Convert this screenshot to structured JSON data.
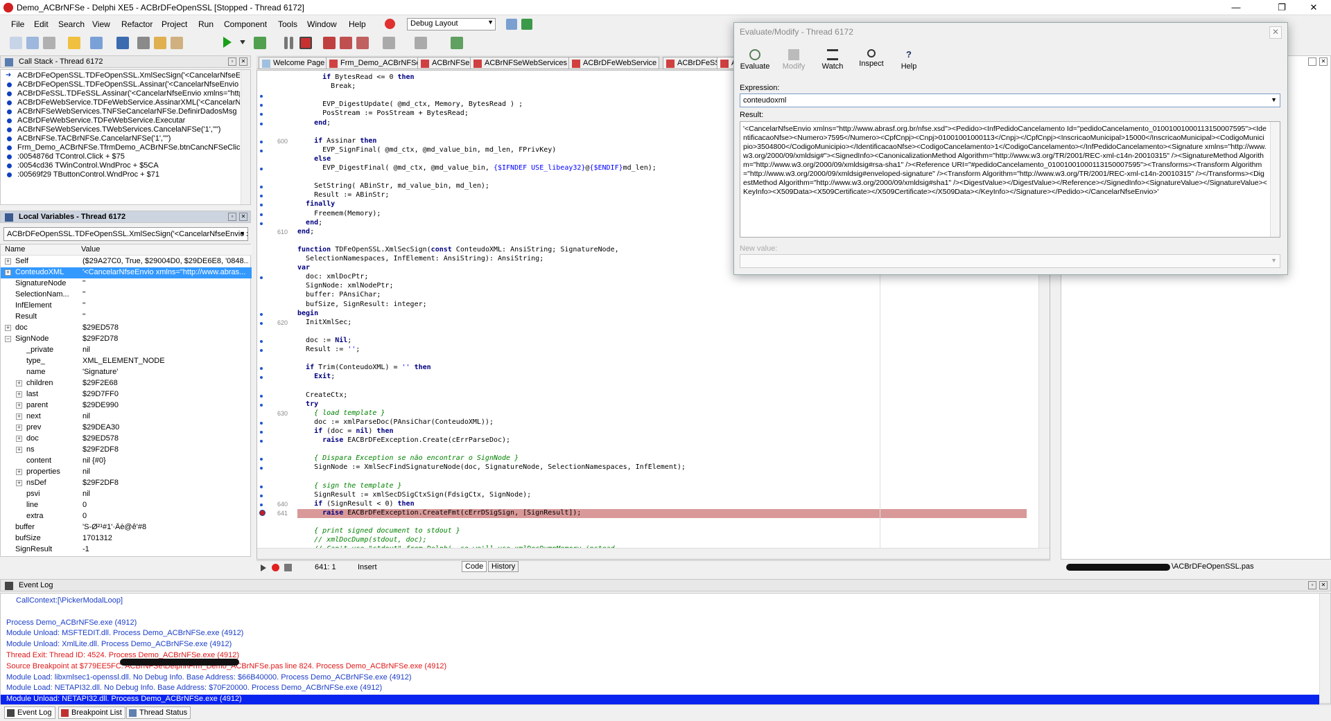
{
  "window": {
    "title": "Demo_ACBrNFSe - Delphi XE5 - ACBrDFeOpenSSL [Stopped - Thread 6172]",
    "minimize": "—",
    "restore": "❐",
    "close": "✕"
  },
  "menu": {
    "items": [
      "File",
      "Edit",
      "Search",
      "View",
      "Refactor",
      "Project",
      "Run",
      "Component",
      "Tools",
      "Window",
      "Help"
    ],
    "layout_combo": "Debug Layout"
  },
  "callstack": {
    "title": "Call Stack - Thread 6172",
    "rows": [
      "ACBrDFeOpenSSL.TDFeOpenSSL.XmlSecSign('<CancelarNfseEnvio",
      "ACBrDFeOpenSSL.TDFeOpenSSL.Assinar('<CancelarNfseEnvio xm",
      "ACBrDFeSSL.TDFeSSL.Assinar('<CancelarNfseEnvio xmlns=\"http:",
      "ACBrDFeWebService.TDFeWebService.AssinarXML('<CancelarNfs",
      "ACBrNFSeWebServices.TNFSeCancelarNFSe.DefinirDadosMsg",
      "ACBrDFeWebService.TDFeWebService.Executar",
      "ACBrNFSeWebServices.TWebServices.CancelaNFSe('1',\"\")",
      "ACBrNFSe.TACBrNFSe.CancelarNFSe('1',\"\")",
      "Frm_Demo_ACBrNFSe.TfrmDemo_ACBrNFSe.btnCancNFSeClick($2",
      ":0054876d TControl.Click + $75",
      ":0054cd36 TWinControl.WndProc + $5CA",
      ":00569f29 TButtonControl.WndProc + $71"
    ]
  },
  "locals": {
    "title": "Local Variables - Thread 6172",
    "selector": "ACBrDFeOpenSSL.TDFeOpenSSL.XmlSecSign('<CancelarNfseEnvio xr",
    "col_name": "Name",
    "col_value": "Value",
    "rows": [
      {
        "name": "Self",
        "value": "($29A27C0, True, $29004D0, $29DE6E8, '0848...",
        "exp": "+"
      },
      {
        "name": "ConteudoXML",
        "value": "'<CancelarNfseEnvio xmlns=\"http://www.abras...",
        "exp": "+"
      },
      {
        "name": "SignatureNode",
        "value": "''",
        "exp": ""
      },
      {
        "name": "SelectionNam...",
        "value": "''",
        "exp": ""
      },
      {
        "name": "InfElement",
        "value": "''",
        "exp": ""
      },
      {
        "name": "Result",
        "value": "''",
        "exp": ""
      },
      {
        "name": "doc",
        "value": "$29ED578",
        "exp": "+"
      },
      {
        "name": "SignNode",
        "value": "$29F2D78",
        "exp": "-"
      },
      {
        "name": "_private",
        "value": "nil",
        "exp": ""
      },
      {
        "name": "type_",
        "value": "XML_ELEMENT_NODE",
        "exp": ""
      },
      {
        "name": "name",
        "value": "'Signature'",
        "exp": ""
      },
      {
        "name": "children",
        "value": "$29F2E68",
        "exp": "+"
      },
      {
        "name": "last",
        "value": "$29D7FF0",
        "exp": "+"
      },
      {
        "name": "parent",
        "value": "$29DE990",
        "exp": "+"
      },
      {
        "name": "next",
        "value": "nil",
        "exp": "+"
      },
      {
        "name": "prev",
        "value": "$29DEA30",
        "exp": "+"
      },
      {
        "name": "doc",
        "value": "$29ED578",
        "exp": "+"
      },
      {
        "name": "ns",
        "value": "$29F2DF8",
        "exp": "+"
      },
      {
        "name": "content",
        "value": "nil {#0}",
        "exp": ""
      },
      {
        "name": "properties",
        "value": "nil",
        "exp": "+"
      },
      {
        "name": "nsDef",
        "value": "$29F2DF8",
        "exp": "+"
      },
      {
        "name": "psvi",
        "value": "nil",
        "exp": ""
      },
      {
        "name": "line",
        "value": "0",
        "exp": ""
      },
      {
        "name": "extra",
        "value": "0",
        "exp": ""
      },
      {
        "name": "buffer",
        "value": "'S-Ø²¹#1'·Âè@ê'#8",
        "exp": ""
      },
      {
        "name": "bufSize",
        "value": "1701312",
        "exp": ""
      },
      {
        "name": "SignResult",
        "value": "-1",
        "exp": ""
      }
    ]
  },
  "editor": {
    "tabs": [
      "Welcome Page",
      "Frm_Demo_ACBrNFSe",
      "ACBrNFSe",
      "ACBrNFSeWebServices",
      "ACBrDFeWebService",
      "ACBrDFeSSL",
      "A"
    ],
    "line_numbers": [
      "600",
      "610",
      "620",
      "630",
      "640",
      "641"
    ],
    "lines": [
      "      if BytesRead <= 0 then",
      "        Break;",
      "",
      "      EVP_DigestUpdate( @md_ctx, Memory, BytesRead ) ;",
      "      PosStream := PosStream + BytesRead;",
      "    end;",
      "",
      "    if Assinar then",
      "      EVP_SignFinal( @md_ctx, @md_value_bin, md_len, FPrivKey)",
      "    else",
      "      EVP_DigestFinal( @md_ctx, @md_value_bin, {$IFNDEF USE_libeay32}@{$ENDIF}md_len);",
      "",
      "    SetString( ABinStr, md_value_bin, md_len);",
      "    Result := ABinStr;",
      "  finally",
      "    Freemem(Memory);",
      "  end;",
      "end;",
      "",
      "function TDFeOpenSSL.XmlSecSign(const ConteudoXML: AnsiString; SignatureNode,",
      "  SelectionNamespaces, InfElement: AnsiString): AnsiString;",
      "var",
      "  doc: xmlDocPtr;",
      "  SignNode: xmlNodePtr;",
      "  buffer: PAnsiChar;",
      "  bufSize, SignResult: integer;",
      "begin",
      "  InitXmlSec;",
      "",
      "  doc := Nil;",
      "  Result := '';",
      "",
      "  if Trim(ConteudoXML) = '' then",
      "    Exit;",
      "",
      "  CreateCtx;",
      "  try",
      "    { load template }",
      "    doc := xmlParseDoc(PAnsiChar(ConteudoXML));",
      "    if (doc = nil) then",
      "      raise EACBrDFeException.Create(cErrParseDoc);",
      "",
      "    { Dispara Exception se não encontrar o SignNode }",
      "    SignNode := XmlSecFindSignatureNode(doc, SignatureNode, SelectionNamespaces, InfElement);",
      "",
      "    { sign the template }",
      "    SignResult := xmlSecDSigCtxSign(FdsigCtx, SignNode);",
      "    if (SignResult < 0) then",
      "      raise EACBrDFeException.CreateFmt(cErrDSigSign, [SignResult]);",
      "",
      "    { print signed document to stdout }",
      "    // xmlDocDump(stdout, doc);",
      "    // Can't use \"stdout\" from Delphi, so we'll use xmlDocDumpMemory instead..."
    ],
    "status_position": "641:  1",
    "status_mode": "Insert",
    "tab_code": "Code",
    "tab_history": "History",
    "right_file": "\\ACBrDFeOpenSSL.pas"
  },
  "eventlog": {
    "title": "Event Log",
    "lines": [
      {
        "text": "CallContext:[\\PickerModalLoop]",
        "kind": "blue",
        "indent": true
      },
      {
        "text": "",
        "kind": "blue"
      },
      {
        "text": "Process Demo_ACBrNFSe.exe (4912)",
        "kind": "blue"
      },
      {
        "text": "Module Unload: MSFTEDIT.dll. Process Demo_ACBrNFSe.exe (4912)",
        "kind": "blue"
      },
      {
        "text": "Module Unload: XmlLite.dll. Process Demo_ACBrNFSe.exe (4912)",
        "kind": "blue"
      },
      {
        "text": "Thread Exit: Thread ID: 4524. Process Demo_ACBrNFSe.exe (4912)",
        "kind": "red"
      },
      {
        "text": "Source Breakpoint at $779EE5FC:                                          ACBrNFSe\\Delphi\\Frm_Demo_ACBrNFSe.pas line 824. Process Demo_ACBrNFSe.exe (4912)",
        "kind": "red"
      },
      {
        "text": "Module Load: libxmlsec1-openssl.dll. No Debug Info. Base Address: $66B40000. Process Demo_ACBrNFSe.exe (4912)",
        "kind": "blue"
      },
      {
        "text": "Module Load: NETAPI32.dll. No Debug Info. Base Address: $70F20000. Process Demo_ACBrNFSe.exe (4912)",
        "kind": "blue"
      },
      {
        "text": "Module Unload: NETAPI32.dll. Process Demo_ACBrNFSe.exe (4912)",
        "kind": "sel"
      }
    ]
  },
  "bottomtabs": [
    "Event Log",
    "Breakpoint List",
    "Thread Status"
  ],
  "evaluate": {
    "title": "Evaluate/Modify - Thread 6172",
    "buttons": [
      "Evaluate",
      "Modify",
      "Watch",
      "Inspect",
      "Help"
    ],
    "expression_label": "Expression:",
    "expression": "conteudoxml",
    "result_label": "Result:",
    "result": "'<CancelarNfseEnvio xmlns=\"http://www.abrasf.org.br/nfse.xsd\"><Pedido><InfPedidoCancelamento Id=\"pedidoCancelamento_01001001000113150007595\"><IdentificacaoNfse><Numero>7595</Numero><CpfCnpj><Cnpj>01001001000113</Cnpj></CpfCnpj><InscricaoMunicipal>15000</InscricaoMunicipal><CodigoMunicipio>3504800</CodigoMunicipio></IdentificacaoNfse><CodigoCancelamento>1</CodigoCancelamento></InfPedidoCancelamento><Signature xmlns=\"http://www.w3.org/2000/09/xmldsig#\"><SignedInfo><CanonicalizationMethod Algorithm=\"http://www.w3.org/TR/2001/REC-xml-c14n-20010315\" /><SignatureMethod Algorithm=\"http://www.w3.org/2000/09/xmldsig#rsa-sha1\" /><Reference URI=\"#pedidoCancelamento_01001001000113150007595\"><Transforms><Transform Algorithm=\"http://www.w3.org/2000/09/xmldsig#enveloped-signature\" /><Transform Algorithm=\"http://www.w3.org/TR/2001/REC-xml-c14n-20010315\" /></Transforms><DigestMethod Algorithm=\"http://www.w3.org/2000/09/xmldsig#sha1\" /><DigestValue></DigestValue></Reference></SignedInfo><SignatureValue></SignatureValue><KeyInfo><X509Data><X509Certificate></X509Certificate></X509Data></KeyInfo></Signature></Pedido></CancelarNfseEnvio>'",
    "newvalue_label": "New value:",
    "close": "✕"
  },
  "colors": {
    "breakpoint_line": "#d99999",
    "keyword": "#000080",
    "comment": "#008000",
    "selection": "#3399ff",
    "eventlog_sel": "#0a24f0"
  }
}
